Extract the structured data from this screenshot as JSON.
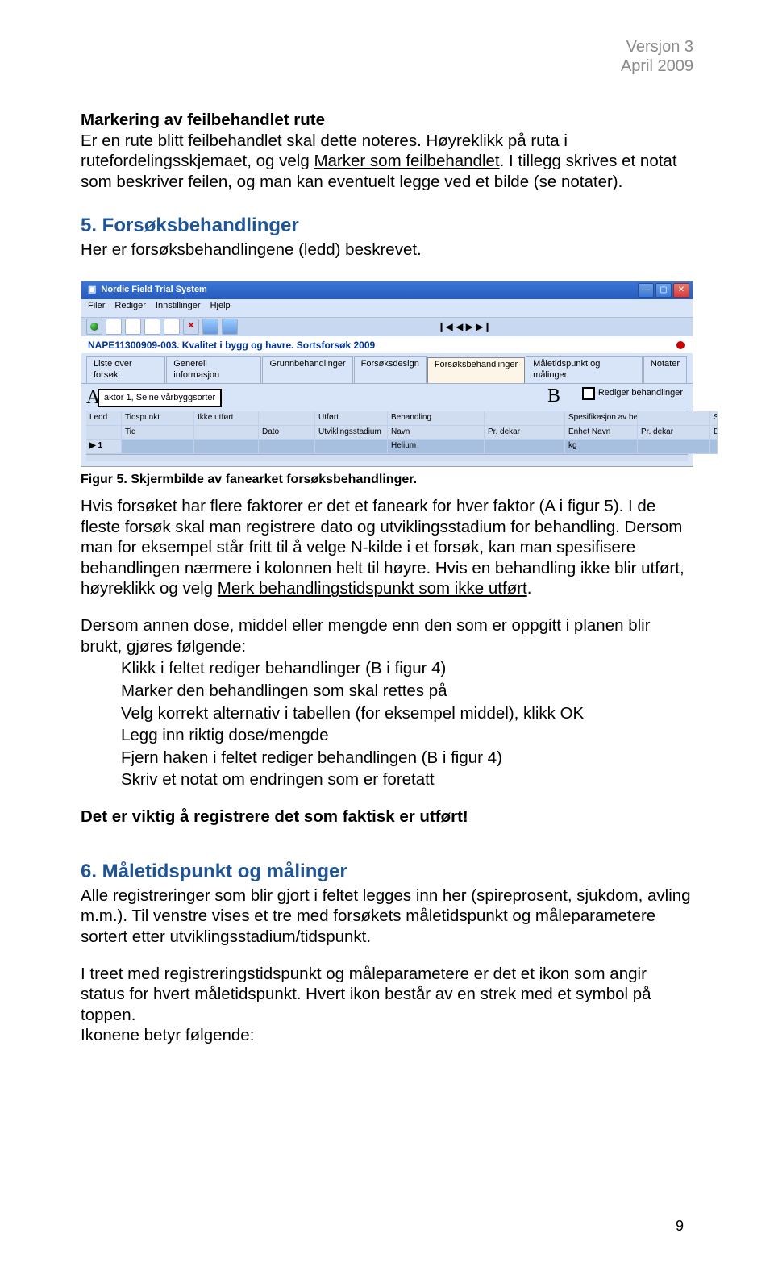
{
  "header": {
    "l1": "Versjon 3",
    "l2": "April 2009"
  },
  "doc": {
    "h_mark": "Markering av feilbehandlet rute",
    "p_mark": "Er en rute blitt feilbehandlet skal dette noteres. Høyreklikk på ruta i rutefordelingsskjemaet, og velg ",
    "p_mark_u": "Marker som feilbehandlet",
    "p_mark_after": ". I tillegg skrives et notat som beskriver feilen, og man kan eventuelt legge ved et bilde (se notater).",
    "h5": "5. Forsøksbehandlinger",
    "p5": "Her er forsøksbehandlingene (ledd) beskrevet.",
    "caption": "Figur 5. Skjermbilde av fanearket forsøksbehandlinger.",
    "p_fig_a": "Hvis forsøket har flere faktorer er det et faneark for hver faktor (A i figur 5). I de fleste forsøk skal man registrere dato og utviklingsstadium for behandling. Dersom man for eksempel står fritt til å velge N-kilde i et forsøk, kan man spesifisere behandlingen nærmere i kolonnen helt til høyre. Hvis en behandling ikke blir utført, høyreklikk og velg ",
    "p_fig_u": "Merk behandlingstidspunkt som ikke utført",
    "p_fig_after": ".",
    "p_dose_intro": "Dersom annen dose, middel eller mengde enn den som er oppgitt i planen blir brukt, gjøres følgende:",
    "list": [
      "Klikk i feltet rediger behandlinger (B i figur 4)",
      "Marker den behandlingen som skal rettes på",
      "Velg korrekt alternativ i tabellen (for eksempel middel), klikk OK",
      "Legg inn riktig dose/mengde",
      "Fjern haken i feltet rediger behandlingen (B i figur 4)",
      "Skriv et notat om endringen som er foretatt"
    ],
    "p_important": "Det er viktig å registrere det som faktisk er utført!",
    "h6": "6. Måletidspunkt og målinger",
    "p6a": "Alle registreringer som blir gjort i feltet legges inn her (spireprosent, sjukdom, avling m.m.). Til venstre vises et tre med forsøkets måletidspunkt og måleparametere sortert etter utviklingsstadium/tidspunkt.",
    "p6b": "I treet med registreringstidspunkt og måleparametere er det et ikon som angir status for hvert måletidspunkt. Hvert ikon består av en strek med et symbol på toppen.",
    "p6c": "Ikonene betyr følgende:"
  },
  "letters": {
    "A": "A",
    "B": "B"
  },
  "shot": {
    "title": "Nordic Field Trial System",
    "menu": [
      "Filer",
      "Rediger",
      "Innstillinger",
      "Hjelp"
    ],
    "nav": "❙◀   ◀   ▶   ▶❙",
    "crumb": "NAPE11300909-003. Kvalitet i bygg og havre. Sortsforsøk 2009",
    "tabs": [
      "Liste over forsøk",
      "Generell informasjon",
      "Grunnbehandlinger",
      "Forsøksdesign",
      "Forsøksbehandlinger",
      "Måletidspunkt og målinger",
      "Notater"
    ],
    "factor": "aktor 1, Seine vårbyggsorter",
    "rediger": "Rediger behandlinger",
    "cols": [
      "Ledd",
      "Tidspunkt",
      "Ikke utført",
      "",
      "Utført",
      "Behandling",
      "",
      "Spesifikasjon av behandling",
      "",
      "Suppl info"
    ],
    "cols2": [
      "",
      "Tid",
      "",
      "Dato",
      "Utviklingsstadium",
      "Navn",
      "Pr. dekar",
      "Enhet Navn",
      "Pr. dekar",
      "Enhet"
    ],
    "row": [
      "▶  1",
      "",
      "",
      "",
      "",
      "Helium",
      "",
      "kg",
      "",
      ""
    ]
  },
  "pagenum": "9"
}
